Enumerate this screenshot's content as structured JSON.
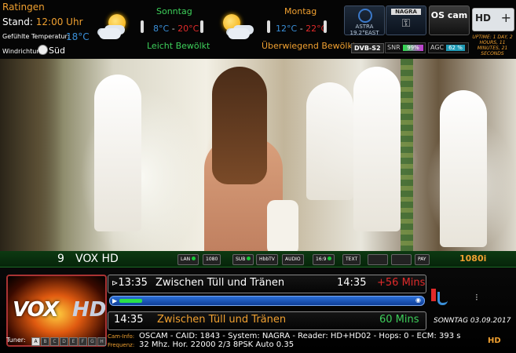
{
  "weather": {
    "city": "Ratingen",
    "stand_label": "Stand:",
    "stand_time": "12:00 Uhr",
    "felt_label": "Gefühlte Temperatur:",
    "felt_value": "18°C",
    "wind_label": "Windrichtung:",
    "wind_value": "Süd",
    "day1": {
      "name": "Sonntag",
      "low": "8°C",
      "high": "20°C",
      "desc": "Leicht Bewölkt",
      "icon": "sun-cloud-icon"
    },
    "day2": {
      "name": "Montag",
      "low": "12°C",
      "high": "22°C",
      "desc": "Überwiegend Bewölkt",
      "icon": "cloud-sun-icon"
    },
    "separator": "-"
  },
  "status": {
    "astra_label": "ASTRA",
    "astra_sub": "19.2°EAST",
    "nagra_label": "NAGRA",
    "oscam_label": "OS cam",
    "hdplus_hd": "HD",
    "hdplus_plus": "+",
    "dvb": "DVB-S2",
    "snr_label": "SNR",
    "snr_value": "99%",
    "snr_level": 0.99,
    "agc_label": "AGC",
    "agc_value": "62 %",
    "agc_level": 0.62,
    "uptime": "UPTIME: 1 DAY, 2 HOURS, 11 MINUTES, 21 SECONDS"
  },
  "channel": {
    "number": "9",
    "name": "VOX HD",
    "flags": [
      "LAN",
      "1080",
      "SUB",
      "HbbTV",
      "AUDIO",
      "16:9",
      "TEXT",
      "",
      "",
      "PAY"
    ],
    "resolution": "1080i",
    "logo_left": "VOX",
    "logo_right": "HD"
  },
  "epg": {
    "now": {
      "start": "13:35",
      "title": "Zwischen Tüll und Tränen",
      "end": "14:35",
      "remaining": "+56 Mins"
    },
    "next": {
      "start": "14:35",
      "title": "Zwischen Tüll und Tränen",
      "duration": "60 Mins"
    },
    "progress": 0.07,
    "date": "SONNTAG 03.09.2017"
  },
  "tuner": {
    "label": "Tuner:",
    "slots": [
      "A",
      "B",
      "C",
      "D",
      "E",
      "F",
      "G",
      "H"
    ],
    "active": "A"
  },
  "cam": {
    "info_label": "Cam-Info:",
    "info_value": "OSCAM - CAID: 1843 - System: NAGRA - Reader: HD+HD02 - Hops: 0 - ECM: 393 s",
    "freq_label": "Frequenz:",
    "freq_value": "32 Mhz. Hor. 22000 2/3 8PSK  Auto 0.35"
  },
  "colors": {
    "accent_orange": "#f0a030",
    "accent_green": "#3dcf5a",
    "accent_red": "#e02a2a",
    "accent_blue": "#3a8fd8"
  }
}
